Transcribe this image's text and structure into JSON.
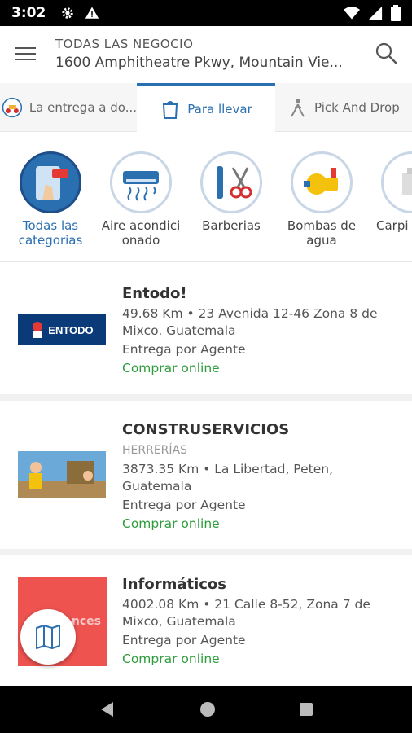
{
  "status_bar": {
    "time": "3:02"
  },
  "header": {
    "subtitle": "TODAS LAS NEGOCIO",
    "address": "1600 Amphitheatre Pkwy, Mountain Vie..."
  },
  "tabs": [
    {
      "label": "La entrega a do..."
    },
    {
      "label": "Para llevar"
    },
    {
      "label": "Pick And Drop"
    }
  ],
  "categories": [
    {
      "label": "Todas las categorias"
    },
    {
      "label": "Aire acondici onado"
    },
    {
      "label": "Barberias"
    },
    {
      "label": "Bombas de agua"
    },
    {
      "label": "Carpi"
    }
  ],
  "businesses": [
    {
      "name": "Entodo!",
      "category": "",
      "address": "49.68 Km • 23 Avenida 12-46 Zona 8 de Mixco. Guatemala",
      "delivery": "Entrega por Agente",
      "action": "Comprar online",
      "logo_text": "ENTODO"
    },
    {
      "name": "CONSTRUSERVICIOS",
      "category": "HERRERÍAS",
      "address": "3873.35 Km • La Libertad, Peten, Guatemala",
      "delivery": "Entrega por Agente",
      "action": "Comprar online"
    },
    {
      "name": "Informáticos",
      "category": "",
      "address": "4002.08 Km • 21 Calle 8-52, Zona 7 de Mixco, Guatemala",
      "delivery": "Entrega por Agente",
      "action": "Comprar online",
      "logo_text": "nces"
    }
  ],
  "colors": {
    "accent": "#2a6fb0",
    "online": "#2e9c3c",
    "entodo_bg": "#0b3a78",
    "informaticos_bg": "#ef5350"
  },
  "icons": {
    "menu": "hamburger-icon",
    "search": "search-icon",
    "map": "map-icon"
  }
}
